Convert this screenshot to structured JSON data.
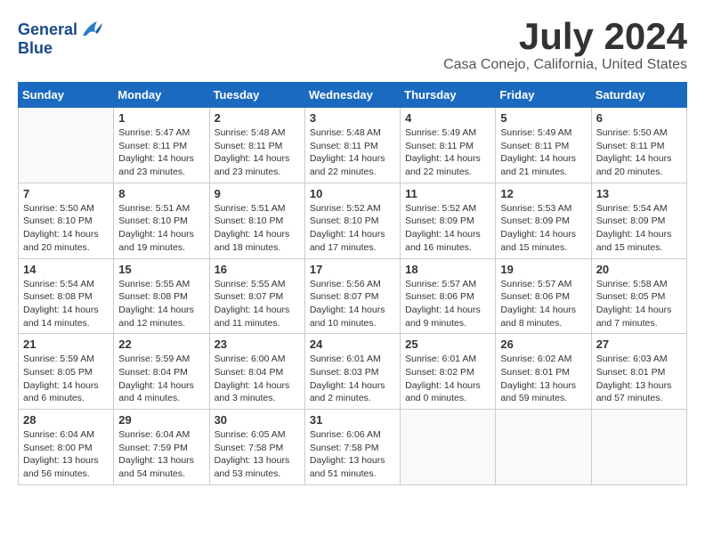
{
  "header": {
    "logo_line1": "General",
    "logo_line2": "Blue",
    "month_year": "July 2024",
    "location": "Casa Conejo, California, United States"
  },
  "weekdays": [
    "Sunday",
    "Monday",
    "Tuesday",
    "Wednesday",
    "Thursday",
    "Friday",
    "Saturday"
  ],
  "weeks": [
    [
      {
        "day": "",
        "info": ""
      },
      {
        "day": "1",
        "info": "Sunrise: 5:47 AM\nSunset: 8:11 PM\nDaylight: 14 hours\nand 23 minutes."
      },
      {
        "day": "2",
        "info": "Sunrise: 5:48 AM\nSunset: 8:11 PM\nDaylight: 14 hours\nand 23 minutes."
      },
      {
        "day": "3",
        "info": "Sunrise: 5:48 AM\nSunset: 8:11 PM\nDaylight: 14 hours\nand 22 minutes."
      },
      {
        "day": "4",
        "info": "Sunrise: 5:49 AM\nSunset: 8:11 PM\nDaylight: 14 hours\nand 22 minutes."
      },
      {
        "day": "5",
        "info": "Sunrise: 5:49 AM\nSunset: 8:11 PM\nDaylight: 14 hours\nand 21 minutes."
      },
      {
        "day": "6",
        "info": "Sunrise: 5:50 AM\nSunset: 8:11 PM\nDaylight: 14 hours\nand 20 minutes."
      }
    ],
    [
      {
        "day": "7",
        "info": "Sunrise: 5:50 AM\nSunset: 8:10 PM\nDaylight: 14 hours\nand 20 minutes."
      },
      {
        "day": "8",
        "info": "Sunrise: 5:51 AM\nSunset: 8:10 PM\nDaylight: 14 hours\nand 19 minutes."
      },
      {
        "day": "9",
        "info": "Sunrise: 5:51 AM\nSunset: 8:10 PM\nDaylight: 14 hours\nand 18 minutes."
      },
      {
        "day": "10",
        "info": "Sunrise: 5:52 AM\nSunset: 8:10 PM\nDaylight: 14 hours\nand 17 minutes."
      },
      {
        "day": "11",
        "info": "Sunrise: 5:52 AM\nSunset: 8:09 PM\nDaylight: 14 hours\nand 16 minutes."
      },
      {
        "day": "12",
        "info": "Sunrise: 5:53 AM\nSunset: 8:09 PM\nDaylight: 14 hours\nand 15 minutes."
      },
      {
        "day": "13",
        "info": "Sunrise: 5:54 AM\nSunset: 8:09 PM\nDaylight: 14 hours\nand 15 minutes."
      }
    ],
    [
      {
        "day": "14",
        "info": "Sunrise: 5:54 AM\nSunset: 8:08 PM\nDaylight: 14 hours\nand 14 minutes."
      },
      {
        "day": "15",
        "info": "Sunrise: 5:55 AM\nSunset: 8:08 PM\nDaylight: 14 hours\nand 12 minutes."
      },
      {
        "day": "16",
        "info": "Sunrise: 5:55 AM\nSunset: 8:07 PM\nDaylight: 14 hours\nand 11 minutes."
      },
      {
        "day": "17",
        "info": "Sunrise: 5:56 AM\nSunset: 8:07 PM\nDaylight: 14 hours\nand 10 minutes."
      },
      {
        "day": "18",
        "info": "Sunrise: 5:57 AM\nSunset: 8:06 PM\nDaylight: 14 hours\nand 9 minutes."
      },
      {
        "day": "19",
        "info": "Sunrise: 5:57 AM\nSunset: 8:06 PM\nDaylight: 14 hours\nand 8 minutes."
      },
      {
        "day": "20",
        "info": "Sunrise: 5:58 AM\nSunset: 8:05 PM\nDaylight: 14 hours\nand 7 minutes."
      }
    ],
    [
      {
        "day": "21",
        "info": "Sunrise: 5:59 AM\nSunset: 8:05 PM\nDaylight: 14 hours\nand 6 minutes."
      },
      {
        "day": "22",
        "info": "Sunrise: 5:59 AM\nSunset: 8:04 PM\nDaylight: 14 hours\nand 4 minutes."
      },
      {
        "day": "23",
        "info": "Sunrise: 6:00 AM\nSunset: 8:04 PM\nDaylight: 14 hours\nand 3 minutes."
      },
      {
        "day": "24",
        "info": "Sunrise: 6:01 AM\nSunset: 8:03 PM\nDaylight: 14 hours\nand 2 minutes."
      },
      {
        "day": "25",
        "info": "Sunrise: 6:01 AM\nSunset: 8:02 PM\nDaylight: 14 hours\nand 0 minutes."
      },
      {
        "day": "26",
        "info": "Sunrise: 6:02 AM\nSunset: 8:01 PM\nDaylight: 13 hours\nand 59 minutes."
      },
      {
        "day": "27",
        "info": "Sunrise: 6:03 AM\nSunset: 8:01 PM\nDaylight: 13 hours\nand 57 minutes."
      }
    ],
    [
      {
        "day": "28",
        "info": "Sunrise: 6:04 AM\nSunset: 8:00 PM\nDaylight: 13 hours\nand 56 minutes."
      },
      {
        "day": "29",
        "info": "Sunrise: 6:04 AM\nSunset: 7:59 PM\nDaylight: 13 hours\nand 54 minutes."
      },
      {
        "day": "30",
        "info": "Sunrise: 6:05 AM\nSunset: 7:58 PM\nDaylight: 13 hours\nand 53 minutes."
      },
      {
        "day": "31",
        "info": "Sunrise: 6:06 AM\nSunset: 7:58 PM\nDaylight: 13 hours\nand 51 minutes."
      },
      {
        "day": "",
        "info": ""
      },
      {
        "day": "",
        "info": ""
      },
      {
        "day": "",
        "info": ""
      }
    ]
  ]
}
